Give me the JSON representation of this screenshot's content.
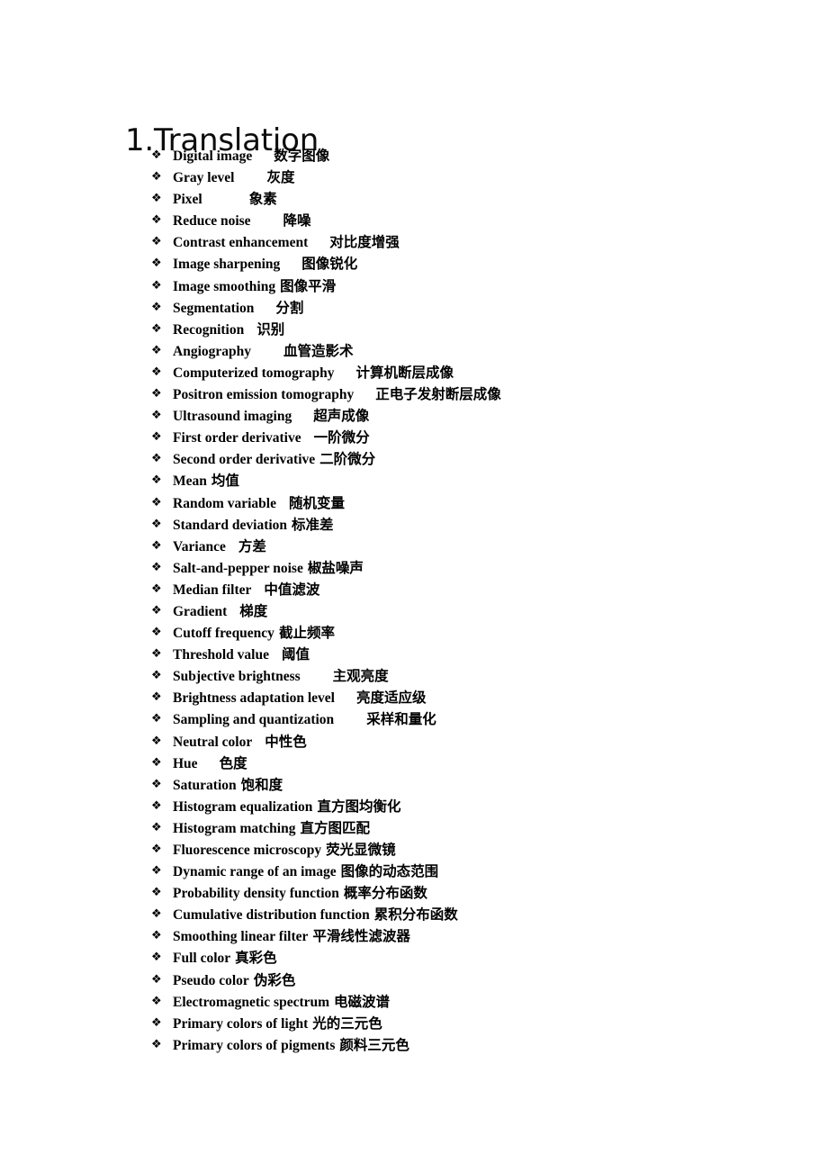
{
  "document": {
    "heading": "1.Translation",
    "bullet_glyph": "❖",
    "bullet_icon_name": "diamond-bullet-icon",
    "text_color": "#000000",
    "background_color": "#ffffff"
  },
  "terms": [
    {
      "en": "Digital image",
      "zh": "数字图像",
      "gap": "lg"
    },
    {
      "en": "Gray level",
      "zh": "灰度",
      "gap": "xl"
    },
    {
      "en": "Pixel",
      "zh": "象素",
      "gap": "xxl"
    },
    {
      "en": "Reduce noise",
      "zh": "降噪",
      "gap": "xl"
    },
    {
      "en": "Contrast enhancement",
      "zh": "对比度增强",
      "gap": "lg"
    },
    {
      "en": "Image sharpening",
      "zh": "图像锐化",
      "gap": "lg"
    },
    {
      "en": "Image smoothing",
      "zh": "图像平滑",
      "gap": "sm"
    },
    {
      "en": "Segmentation",
      "zh": "分割",
      "gap": "lg"
    },
    {
      "en": "Recognition",
      "zh": "识别",
      "gap": "md"
    },
    {
      "en": "Angiography",
      "zh": "血管造影术",
      "gap": "xl"
    },
    {
      "en": "Computerized tomography",
      "zh": "计算机断层成像",
      "gap": "lg"
    },
    {
      "en": "Positron emission tomography",
      "zh": "正电子发射断层成像",
      "gap": "lg"
    },
    {
      "en": "Ultrasound imaging",
      "zh": "超声成像",
      "gap": "lg"
    },
    {
      "en": "First order derivative",
      "zh": "一阶微分",
      "gap": "md"
    },
    {
      "en": "Second order derivative",
      "zh": "二阶微分",
      "gap": "sm"
    },
    {
      "en": "Mean",
      "zh": "均值",
      "gap": "sm"
    },
    {
      "en": "Random variable",
      "zh": "随机变量",
      "gap": "md"
    },
    {
      "en": "Standard deviation",
      "zh": "标准差",
      "gap": "sm"
    },
    {
      "en": "Variance",
      "zh": "方差",
      "gap": "md"
    },
    {
      "en": "Salt-and-pepper noise",
      "zh": "椒盐噪声",
      "gap": "sm"
    },
    {
      "en": "Median filter",
      "zh": "中值滤波",
      "gap": "md"
    },
    {
      "en": "Gradient",
      "zh": "梯度",
      "gap": "md"
    },
    {
      "en": "Cutoff frequency",
      "zh": "截止频率",
      "gap": "sm"
    },
    {
      "en": "Threshold value",
      "zh": "阈值",
      "gap": "md"
    },
    {
      "en": "Subjective brightness",
      "zh": "主观亮度",
      "gap": "xl"
    },
    {
      "en": "Brightness adaptation level",
      "zh": "亮度适应级",
      "gap": "lg"
    },
    {
      "en": "Sampling and quantization",
      "zh": "采样和量化",
      "gap": "xl"
    },
    {
      "en": "Neutral color",
      "zh": "中性色",
      "gap": "md"
    },
    {
      "en": "Hue",
      "zh": "色度",
      "gap": "lg"
    },
    {
      "en": "Saturation",
      "zh": "饱和度",
      "gap": "sm"
    },
    {
      "en": "Histogram equalization",
      "zh": "直方图均衡化",
      "gap": "sm"
    },
    {
      "en": "Histogram matching",
      "zh": "直方图匹配",
      "gap": "sm"
    },
    {
      "en": "Fluorescence microscopy",
      "zh": "荧光显微镜",
      "gap": "sm"
    },
    {
      "en": "Dynamic range of an image",
      "zh": "图像的动态范围",
      "gap": "sm"
    },
    {
      "en": "Probability density function",
      "zh": "概率分布函数",
      "gap": "sm"
    },
    {
      "en": "Cumulative distribution function",
      "zh": "累积分布函数",
      "gap": "sm"
    },
    {
      "en": "Smoothing linear filter",
      "zh": "平滑线性滤波器",
      "gap": "sm"
    },
    {
      "en": "Full color",
      "zh": "真彩色",
      "gap": "sm"
    },
    {
      "en": "Pseudo color",
      "zh": "伪彩色",
      "gap": "sm"
    },
    {
      "en": "Electromagnetic spectrum",
      "zh": "电磁波谱",
      "gap": "sm"
    },
    {
      "en": "Primary colors of light",
      "zh": "光的三元色",
      "gap": "sm"
    },
    {
      "en": "Primary colors of pigments",
      "zh": "颜料三元色",
      "gap": "sm"
    }
  ]
}
